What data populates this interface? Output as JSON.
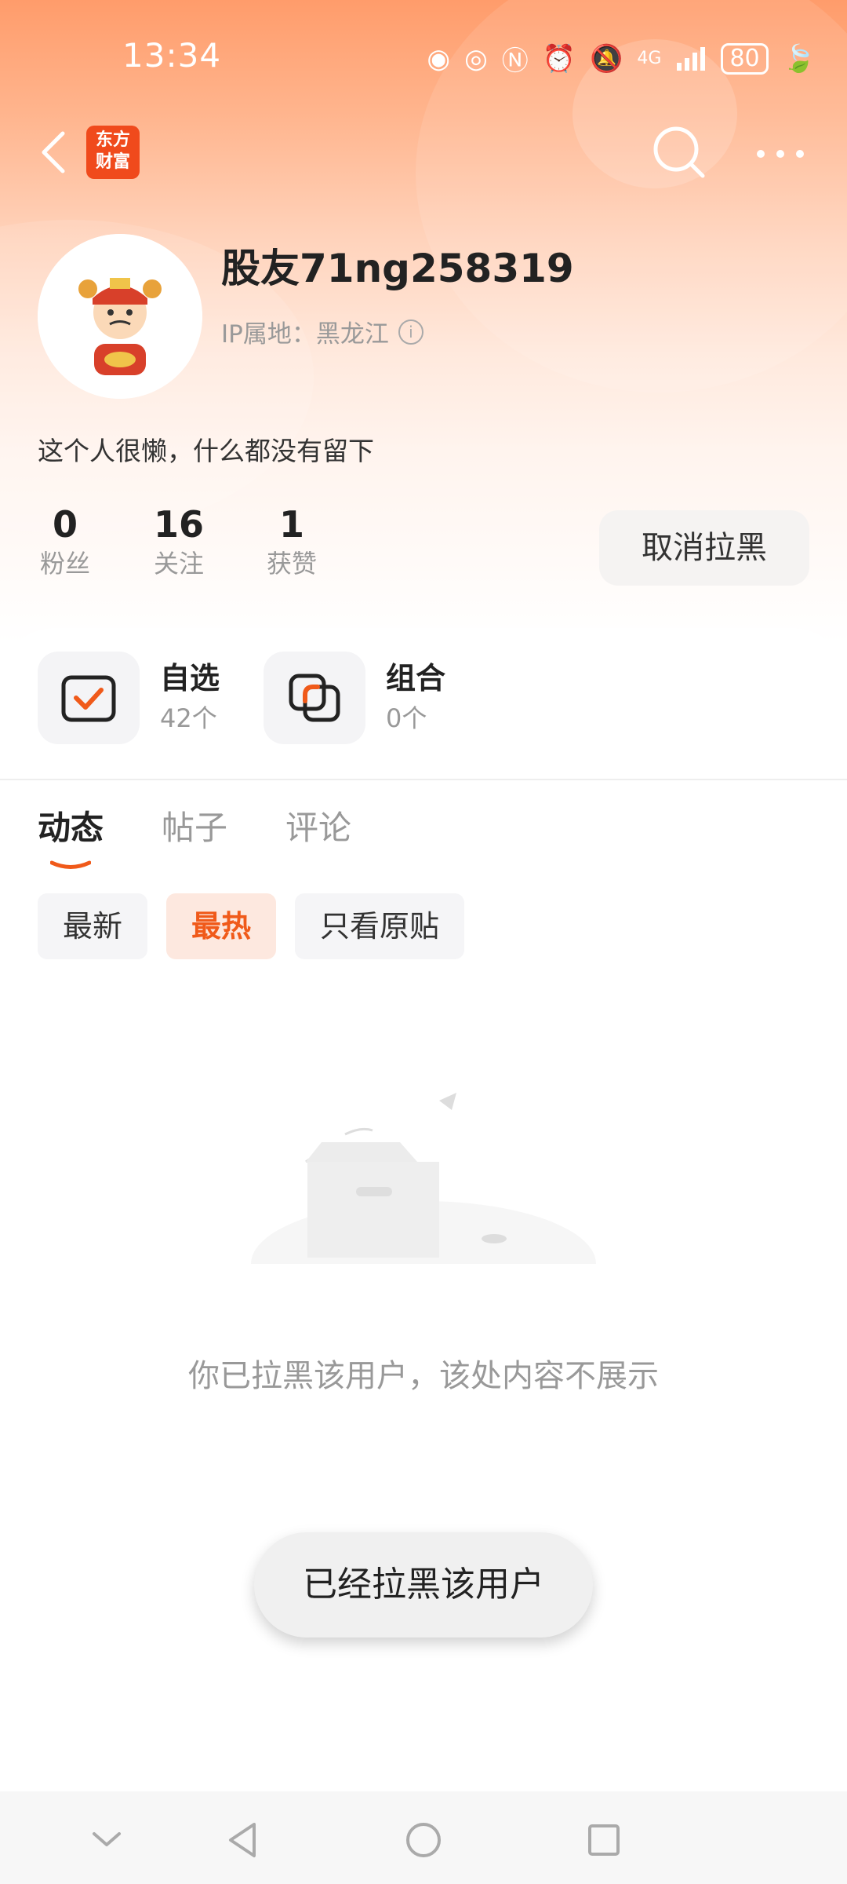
{
  "status_bar": {
    "time": "13:34",
    "network": "4G",
    "battery": "80",
    "icons": [
      "hd-icon",
      "eye-icon",
      "nfc-icon",
      "alarm-icon",
      "mute-icon",
      "signal-icon",
      "battery-icon",
      "leaf-icon"
    ]
  },
  "header": {
    "logo_text_line1": "东方",
    "logo_text_line2": "财富",
    "icons": [
      "back-icon",
      "search-icon",
      "more-icon"
    ]
  },
  "profile": {
    "username": "股友71ng258319",
    "ip_label": "IP属地：黑龙江",
    "bio": "这个人很懒，什么都没有留下",
    "stats": [
      {
        "value": "0",
        "label": "粉丝"
      },
      {
        "value": "16",
        "label": "关注"
      },
      {
        "value": "1",
        "label": "获赞"
      }
    ],
    "unblock_label": "取消拉黑"
  },
  "quick_items": [
    {
      "title": "自选",
      "subtitle": "42个",
      "icon": "watchlist-icon"
    },
    {
      "title": "组合",
      "subtitle": "0个",
      "icon": "portfolio-icon"
    }
  ],
  "tabs": [
    "动态",
    "帖子",
    "评论"
  ],
  "filters": [
    "最新",
    "最热",
    "只看原贴"
  ],
  "active_filter": "最热",
  "empty_message": "你已拉黑该用户，该处内容不展示",
  "toast": "已经拉黑该用户",
  "colors": {
    "accent": "#f05a1a",
    "header_gradient_top": "#ff9c6b"
  }
}
